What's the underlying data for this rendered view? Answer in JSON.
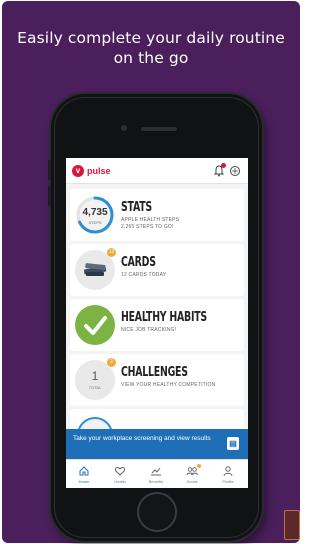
{
  "headline": {
    "line1": "Easily complete your daily routine",
    "line2": "on the go"
  },
  "app": {
    "logo_text": "pulse",
    "colors": {
      "brand": "#d9173b",
      "accent": "#1f6fb8",
      "habits": "#7cb342",
      "badge": "#f2a93b",
      "background": "#4a1f5c"
    }
  },
  "cards": {
    "stats": {
      "title": "STATS",
      "subtitle1": "APPLE HEALTH STEPS",
      "subtitle2": "2,265 STEPS TO GO!",
      "steps": "4,735",
      "steps_unit": "STEPS",
      "progress": 0.68
    },
    "cards": {
      "title": "CARDS",
      "subtitle": "12 CARDS TODAY",
      "badge": "12"
    },
    "habits": {
      "title": "HEALTHY HABITS",
      "subtitle": "NICE JOB TRACKING!"
    },
    "challenges": {
      "title": "CHALLENGES",
      "subtitle": "VIEW YOUR HEALTHY COMPETITION",
      "count": "1",
      "count_unit": "TOTAL",
      "badge": "2"
    }
  },
  "banner": {
    "text": "Take your workplace screening and view results",
    "icon": "document-icon"
  },
  "tabs": [
    {
      "label": "Home",
      "icon": "home-icon"
    },
    {
      "label": "Health",
      "icon": "heart-icon"
    },
    {
      "label": "Benefits",
      "icon": "benefits-icon"
    },
    {
      "label": "Social",
      "icon": "social-icon"
    },
    {
      "label": "Profile",
      "icon": "profile-icon"
    }
  ]
}
